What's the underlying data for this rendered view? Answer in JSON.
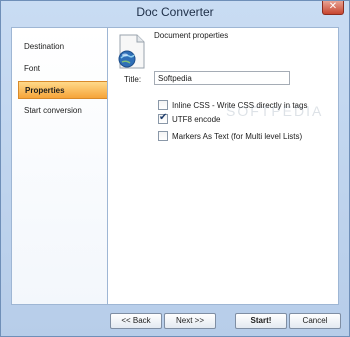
{
  "window": {
    "title": "Doc Converter",
    "close_glyph": "✕"
  },
  "sidebar": {
    "items": [
      {
        "label": "Destination"
      },
      {
        "label": "Font"
      },
      {
        "label": "Properties",
        "active": true
      },
      {
        "label": "Start conversion"
      }
    ]
  },
  "content": {
    "section_title": "Document properties",
    "icon": "document-globe-icon",
    "title_field": {
      "label": "Title:",
      "value": "Softpedia"
    },
    "options": [
      {
        "label": "Inline CSS - Write CSS directly in tags",
        "checked": false
      },
      {
        "label": "UTF8 encode",
        "checked": true
      },
      {
        "label": "Markers As Text (for Multi level Lists)",
        "checked": false
      }
    ],
    "watermark": "SOFTPEDIA"
  },
  "footer": {
    "back_label": "<< Back",
    "next_label": "Next >>",
    "start_label": "Start!",
    "cancel_label": "Cancel"
  },
  "colors": {
    "frame": "#c9dcf3",
    "active_item": "#f6a43a",
    "close_button": "#c7452f"
  }
}
